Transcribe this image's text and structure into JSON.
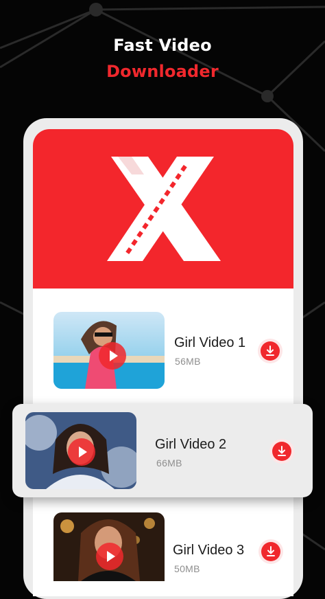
{
  "header": {
    "line1": "Fast Video",
    "line2": "Downloader"
  },
  "colors": {
    "accent": "#f0282d",
    "background": "#050505",
    "card": "#ffffff",
    "highlight_card": "#ececec"
  },
  "videos": [
    {
      "title": "Girl Video 1",
      "size": "56MB",
      "icon": "download-icon"
    },
    {
      "title": "Girl Video 2",
      "size": "66MB",
      "icon": "download-icon"
    },
    {
      "title": "Girl Video 3",
      "size": "50MB",
      "icon": "download-icon"
    }
  ]
}
